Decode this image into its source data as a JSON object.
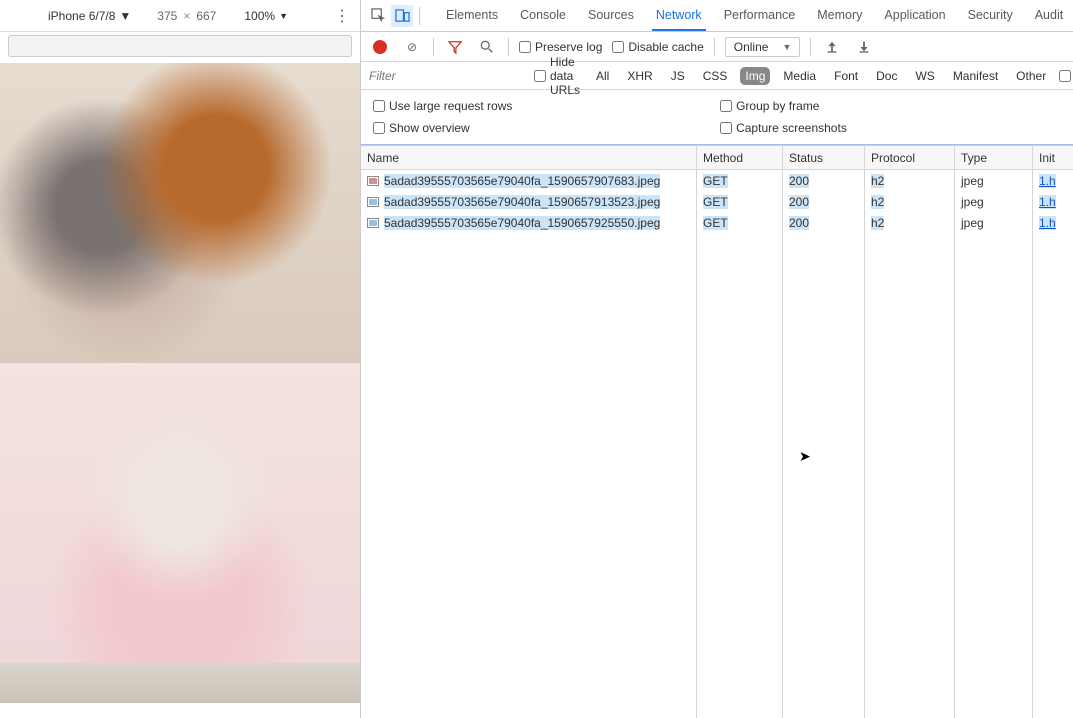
{
  "device": {
    "name": "iPhone 6/7/8",
    "width": "375",
    "height": "667",
    "zoom": "100%"
  },
  "tabs": {
    "items": [
      "Elements",
      "Console",
      "Sources",
      "Network",
      "Performance",
      "Memory",
      "Application",
      "Security",
      "Audit"
    ],
    "active": "Network"
  },
  "net_toolbar": {
    "preserve_log": "Preserve log",
    "disable_cache": "Disable cache",
    "throttle": "Online"
  },
  "filter": {
    "placeholder": "Filter",
    "hide_data_urls": "Hide data URLs",
    "chips": [
      "All",
      "XHR",
      "JS",
      "CSS",
      "Img",
      "Media",
      "Font",
      "Doc",
      "WS",
      "Manifest",
      "Other"
    ],
    "active_chip": "Img"
  },
  "options": {
    "use_large": "Use large request rows",
    "show_overview": "Show overview",
    "group_by_frame": "Group by frame",
    "capture_screenshots": "Capture screenshots"
  },
  "columns": {
    "name": "Name",
    "method": "Method",
    "status": "Status",
    "protocol": "Protocol",
    "type": "Type",
    "initiator": "Init"
  },
  "rows": [
    {
      "icon": "pink",
      "name": "5adad39555703565e79040fa_1590657907683.jpeg",
      "method": "GET",
      "status": "200",
      "protocol": "h2",
      "type": "jpeg",
      "initiator": "1.h"
    },
    {
      "icon": "blue",
      "name": "5adad39555703565e79040fa_1590657913523.jpeg",
      "method": "GET",
      "status": "200",
      "protocol": "h2",
      "type": "jpeg",
      "initiator": "1.h"
    },
    {
      "icon": "blue",
      "name": "5adad39555703565e79040fa_1590657925550.jpeg",
      "method": "GET",
      "status": "200",
      "protocol": "h2",
      "type": "jpeg",
      "initiator": "1.h"
    }
  ]
}
